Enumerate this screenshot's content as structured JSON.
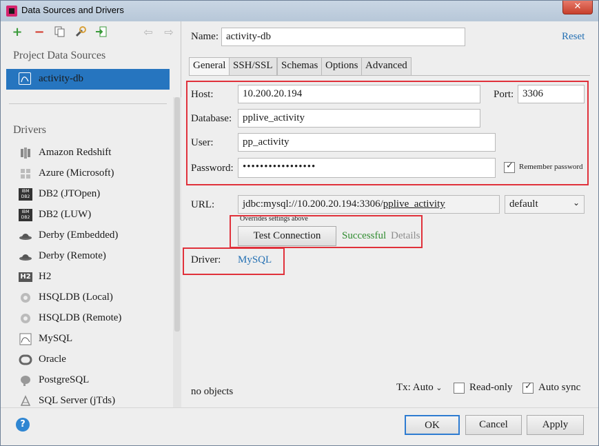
{
  "window": {
    "title": "Data Sources and Drivers",
    "close_glyph": "✕"
  },
  "toolbar": {
    "icons": [
      "add-icon",
      "remove-icon",
      "duplicate-icon",
      "settings-icon",
      "import-icon",
      "back-icon",
      "forward-icon"
    ]
  },
  "sidebar": {
    "project_header": "Project Data Sources",
    "project_items": [
      {
        "label": "activity-db",
        "icon": "mysql-icon"
      }
    ],
    "drivers_header": "Drivers",
    "drivers": [
      {
        "label": "Amazon Redshift",
        "icon": "redshift-icon"
      },
      {
        "label": "Azure (Microsoft)",
        "icon": "windows-icon"
      },
      {
        "label": "DB2 (JTOpen)",
        "icon": "db2-icon"
      },
      {
        "label": "DB2 (LUW)",
        "icon": "db2-icon"
      },
      {
        "label": "Derby (Embedded)",
        "icon": "derby-hat-icon"
      },
      {
        "label": "Derby (Remote)",
        "icon": "derby-hat-icon"
      },
      {
        "label": "H2",
        "icon": "h2-icon"
      },
      {
        "label": "HSQLDB (Local)",
        "icon": "hsqldb-icon"
      },
      {
        "label": "HSQLDB (Remote)",
        "icon": "hsqldb-icon"
      },
      {
        "label": "MySQL",
        "icon": "mysql-icon"
      },
      {
        "label": "Oracle",
        "icon": "oracle-icon"
      },
      {
        "label": "PostgreSQL",
        "icon": "postgresql-icon"
      },
      {
        "label": "SQL Server (jTds)",
        "icon": "sqlserver-icon"
      }
    ],
    "icon_glyphs": {
      "db2": "IBM DB2",
      "h2": "H2"
    }
  },
  "form": {
    "name_label": "Name:",
    "name_value": "activity-db",
    "reset_label": "Reset",
    "tabs": [
      "General",
      "SSH/SSL",
      "Schemas",
      "Options",
      "Advanced"
    ],
    "active_tab": "General",
    "host_label": "Host:",
    "host_value": "10.200.20.194",
    "port_label": "Port:",
    "port_value": "3306",
    "database_label": "Database:",
    "database_value": "pplive_activity",
    "user_label": "User:",
    "user_value": "pp_activity",
    "password_label": "Password:",
    "password_value": "•••••••••••••••••",
    "remember_password_label": "Remember password",
    "remember_password_checked": true,
    "url_label": "URL:",
    "url_prefix": "jdbc:mysql://10.200.20.194:3306/",
    "url_db": "pplive_activity",
    "url_mode": "default",
    "overrides_note": "Overrides settings above",
    "test_connection_label": "Test Connection",
    "test_status": "Successful",
    "details_label": "Details",
    "driver_label": "Driver:",
    "driver_value": "MySQL",
    "objects_status": "no objects",
    "tx_label": "Tx: Auto",
    "read_only_label": "Read-only",
    "read_only_checked": false,
    "auto_sync_label": "Auto sync",
    "auto_sync_checked": true
  },
  "footer": {
    "help_glyph": "?",
    "ok_label": "OK",
    "cancel_label": "Cancel",
    "apply_label": "Apply"
  },
  "colors": {
    "selection": "#2675bf",
    "link": "#2470b3",
    "success": "#2e8b2e",
    "highlight_box": "#e0303a"
  }
}
